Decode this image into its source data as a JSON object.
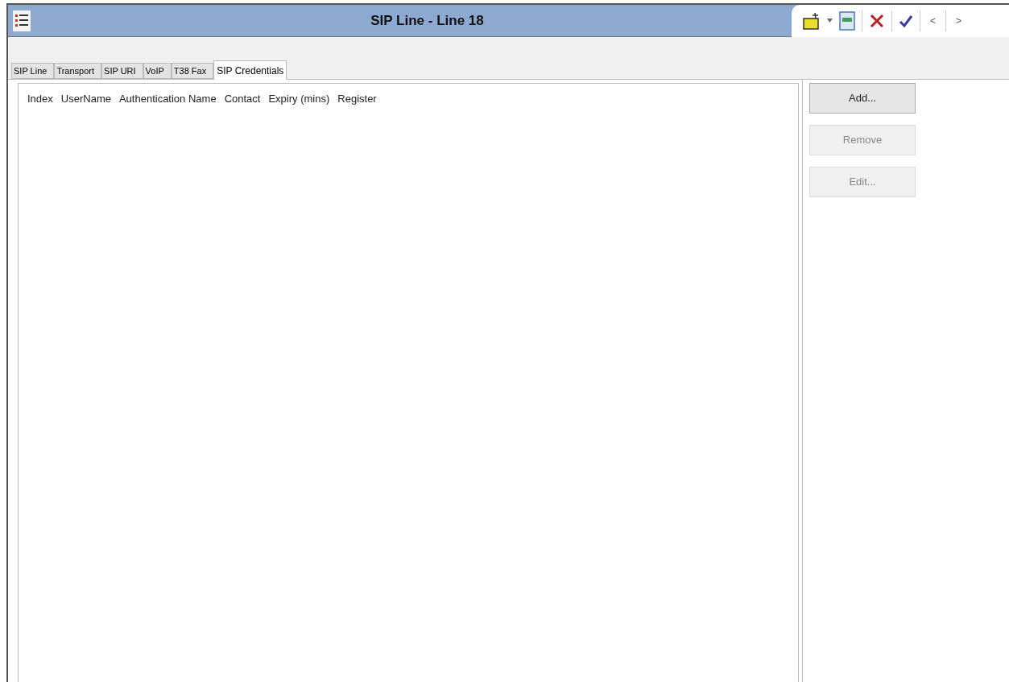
{
  "window": {
    "title": "SIP Line - Line 18"
  },
  "toolbar": {
    "prev": "<",
    "next": ">"
  },
  "tabs": [
    {
      "label": "SIP Line",
      "selected": false
    },
    {
      "label": "Transport",
      "selected": false
    },
    {
      "label": "SIP URI",
      "selected": false
    },
    {
      "label": "VoIP",
      "selected": false
    },
    {
      "label": "T38 Fax",
      "selected": false
    },
    {
      "label": "SIP Credentials",
      "selected": true
    }
  ],
  "table": {
    "columns": [
      "Index",
      "UserName",
      "Authentication Name",
      "Contact",
      "Expiry (mins)",
      "Register"
    ]
  },
  "buttons": [
    {
      "label": "Add...",
      "disabled": false
    },
    {
      "label": "Remove",
      "disabled": true
    },
    {
      "label": "Edit...",
      "disabled": true
    }
  ]
}
